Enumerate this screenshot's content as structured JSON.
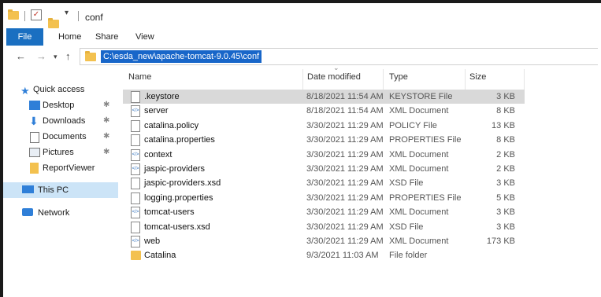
{
  "window": {
    "title": "conf"
  },
  "ribbon": {
    "tabs": [
      "File",
      "Home",
      "Share",
      "View"
    ]
  },
  "address": {
    "path": "C:\\esda_new\\apache-tomcat-9.0.45\\conf"
  },
  "sidebar": {
    "items": [
      {
        "label": "Quick access",
        "icon": "star-icon",
        "pinned": false
      },
      {
        "label": "Desktop",
        "icon": "desktop-icon",
        "pinned": true
      },
      {
        "label": "Downloads",
        "icon": "download-icon",
        "pinned": true
      },
      {
        "label": "Documents",
        "icon": "document-icon",
        "pinned": true
      },
      {
        "label": "Pictures",
        "icon": "picture-icon",
        "pinned": true
      },
      {
        "label": "ReportViewer",
        "icon": "folder-icon",
        "pinned": false
      },
      {
        "label": "This PC",
        "icon": "computer-icon",
        "pinned": false
      },
      {
        "label": "Network",
        "icon": "network-icon",
        "pinned": false
      }
    ]
  },
  "columns": {
    "name": "Name",
    "date": "Date modified",
    "type": "Type",
    "size": "Size"
  },
  "files": [
    {
      "name": ".keystore",
      "date": "8/18/2021 11:54 AM",
      "type": "KEYSTORE File",
      "size": "3 KB",
      "icon": "file"
    },
    {
      "name": "server",
      "date": "8/18/2021 11:54 AM",
      "type": "XML Document",
      "size": "8 KB",
      "icon": "xml"
    },
    {
      "name": "catalina.policy",
      "date": "3/30/2021 11:29 AM",
      "type": "POLICY File",
      "size": "13 KB",
      "icon": "file"
    },
    {
      "name": "catalina.properties",
      "date": "3/30/2021 11:29 AM",
      "type": "PROPERTIES File",
      "size": "8 KB",
      "icon": "file"
    },
    {
      "name": "context",
      "date": "3/30/2021 11:29 AM",
      "type": "XML Document",
      "size": "2 KB",
      "icon": "xml"
    },
    {
      "name": "jaspic-providers",
      "date": "3/30/2021 11:29 AM",
      "type": "XML Document",
      "size": "2 KB",
      "icon": "xml"
    },
    {
      "name": "jaspic-providers.xsd",
      "date": "3/30/2021 11:29 AM",
      "type": "XSD File",
      "size": "3 KB",
      "icon": "file"
    },
    {
      "name": "logging.properties",
      "date": "3/30/2021 11:29 AM",
      "type": "PROPERTIES File",
      "size": "5 KB",
      "icon": "file"
    },
    {
      "name": "tomcat-users",
      "date": "3/30/2021 11:29 AM",
      "type": "XML Document",
      "size": "3 KB",
      "icon": "xml"
    },
    {
      "name": "tomcat-users.xsd",
      "date": "3/30/2021 11:29 AM",
      "type": "XSD File",
      "size": "3 KB",
      "icon": "file"
    },
    {
      "name": "web",
      "date": "3/30/2021 11:29 AM",
      "type": "XML Document",
      "size": "173 KB",
      "icon": "xml"
    },
    {
      "name": "Catalina",
      "date": "9/3/2021 11:03 AM",
      "type": "File folder",
      "size": "",
      "icon": "folder"
    }
  ]
}
